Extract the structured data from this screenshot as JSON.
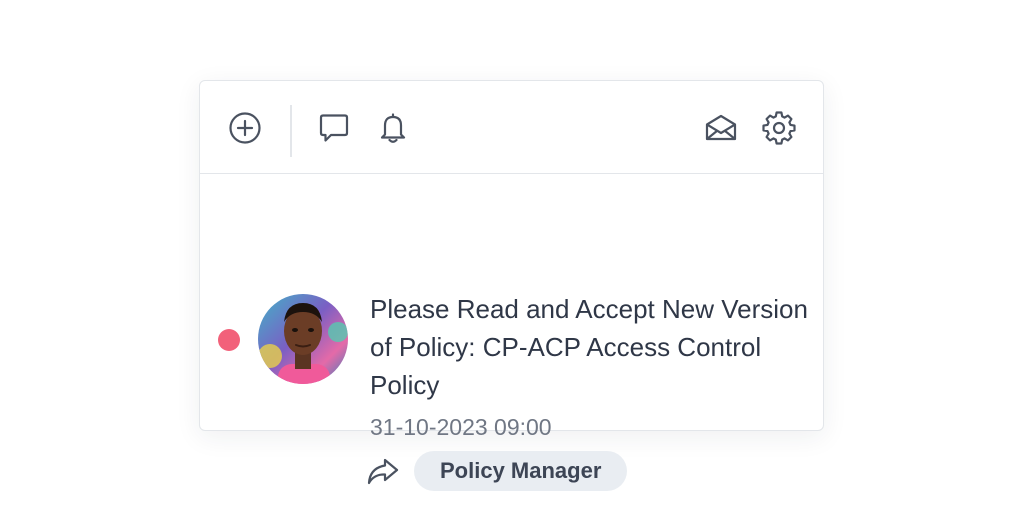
{
  "toolbar": {
    "icons": {
      "add": "plus-circle-icon",
      "chat": "chat-bubble-icon",
      "notifications": "bell-icon",
      "mark_read": "open-envelope-icon",
      "settings": "gear-icon"
    }
  },
  "notification": {
    "unread": true,
    "unread_color": "#f2617a",
    "title": "Please Read and Accept New Version of Policy: CP-ACP Access Control Policy",
    "timestamp": "31-10-2023 09:00",
    "action_icon": "share-arrow-icon",
    "tag": "Policy Manager"
  },
  "colors": {
    "icon": "#4a5260",
    "text": "#2f3747",
    "muted": "#707784",
    "tag_bg": "#e9edf2",
    "border": "#e3e6ea"
  }
}
